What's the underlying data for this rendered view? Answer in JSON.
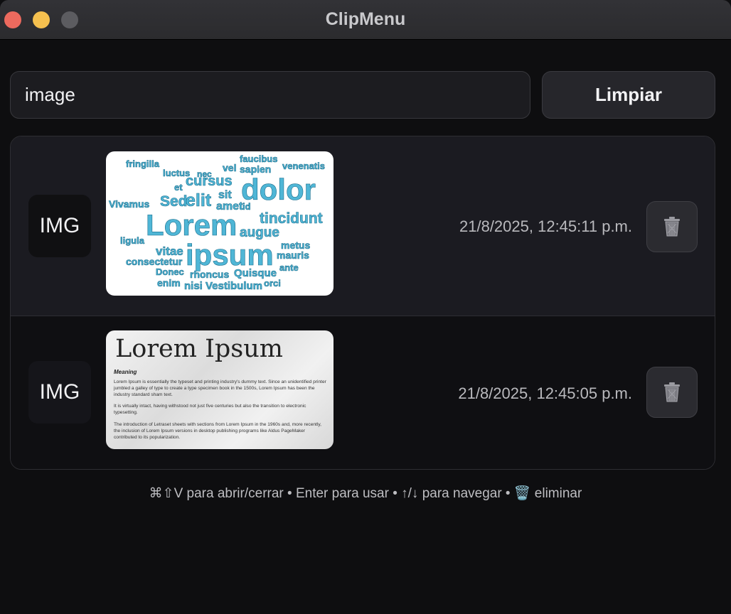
{
  "window": {
    "title": "ClipMenu"
  },
  "search": {
    "value": "image"
  },
  "toolbar": {
    "clear_label": "Limpiar"
  },
  "items": [
    {
      "badge": "IMG",
      "timestamp": "21/8/2025, 12:45:11 p.m.",
      "preview_kind": "word-cloud",
      "preview_words": [
        "fringilla",
        "faucibus",
        "venenatis",
        "sapien",
        "luctus",
        "nec",
        "vel",
        "dolor",
        "cursus",
        "et",
        "Sed",
        "elit",
        "sit",
        "amet",
        "id",
        "Vivamus",
        "tincidunt",
        "Lorem",
        "augue",
        "ipsum",
        "vitae",
        "metus",
        "mauris",
        "ligula",
        "consectetur",
        "ante",
        "Donec",
        "rhoncus",
        "Quisque",
        "enim",
        "nisi",
        "Vestibulum",
        "orci"
      ],
      "delete_icon": "trash-icon"
    },
    {
      "badge": "IMG",
      "timestamp": "21/8/2025, 12:45:05 p.m.",
      "preview_kind": "document",
      "preview_title": "Lorem Ipsum",
      "preview_heading": "Meaning",
      "preview_paragraphs": [
        "Lorem Ipsum is essentially the typeset and printing industry's dummy text. Since an unidentified printer jumbled a galley of type to create a type specimen book in the 1500s, Lorem Ipsum has been the industry standard sham text.",
        "It is virtually intact, having withstood not just five centuries but also the transition to electronic typesetting.",
        "The introduction of Letraset sheets with sections from Lorem Ipsum in the 1960s and, more recently, the inclusion of Lorem Ipsum versions in desktop publishing programs like Aldus PageMaker contributed to its popularization."
      ],
      "delete_icon": "trash-icon"
    }
  ],
  "footer": {
    "hint": "⌘⇧V para abrir/cerrar • Enter para usar • ↑/↓ para navegar • 🗑️ eliminar"
  },
  "colors": {
    "accent_cloud": "#4fb6d6",
    "window_bg": "#0e0e10",
    "close": "#ed6a5e",
    "minimize": "#f5c04f",
    "maximize": "#5c5c60"
  }
}
